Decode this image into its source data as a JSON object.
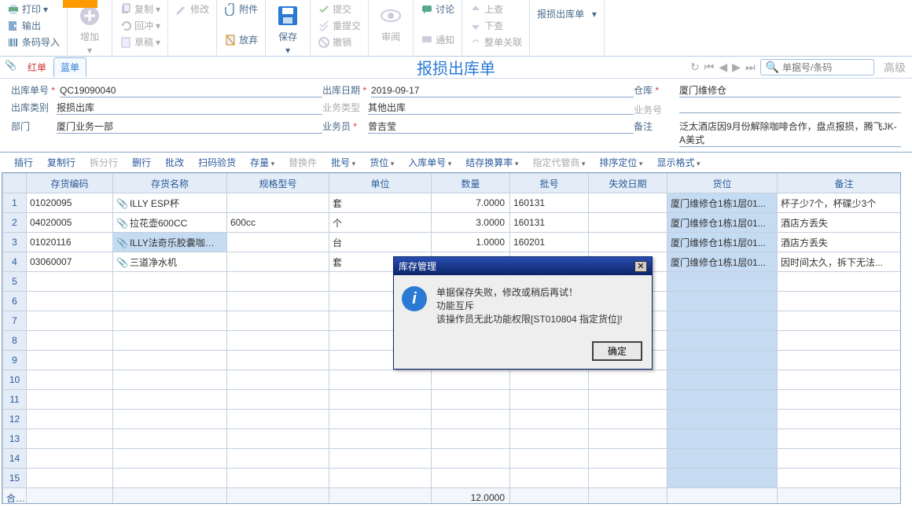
{
  "ribbon": {
    "print": "打印",
    "output": "输出",
    "barcode_import": "条码导入",
    "add": "增加",
    "copy": "复制",
    "return": "回冲",
    "draft": "草稿",
    "modify": "修改",
    "attachment": "附件",
    "abandon": "放弃",
    "save": "保存",
    "submit": "提交",
    "resubmit": "重提交",
    "revoke": "撤销",
    "review": "审阅",
    "discuss": "讨论",
    "notify": "通知",
    "check_up": "上查",
    "check_down": "下查",
    "close_rel": "整单关联",
    "doc_type": "报损出库单"
  },
  "tabs": {
    "red": "红单",
    "blue": "蓝单"
  },
  "title": "报损出库单",
  "search": {
    "placeholder": "单据号/条码",
    "adv": "高级"
  },
  "form": {
    "out_no_label": "出库单号",
    "out_no": "QC19090040",
    "out_cat_label": "出库类别",
    "out_cat": "报损出库",
    "dept_label": "部门",
    "dept": "厦门业务一部",
    "out_date_label": "出库日期",
    "out_date": "2019-09-17",
    "biz_type_label": "业务类型",
    "biz_type": "其他出库",
    "clerk_label": "业务员",
    "clerk": "曾吉莹",
    "wh_label": "仓库",
    "wh": "厦门维修仓",
    "biz_no_label": "业务号",
    "remark_label": "备注",
    "remark": "泛太酒店因9月份解除咖啡合作，盘点报损，腾飞JK-A美式"
  },
  "grid_toolbar": {
    "insert": "插行",
    "copyrow": "复制行",
    "split": "拆分行",
    "del": "删行",
    "batch_modify": "批改",
    "scan": "扫码验货",
    "stock": "存量",
    "replace": "替换件",
    "batch": "批号",
    "loc": "货位",
    "in_no": "入库单号",
    "settle": "结存换算率",
    "agent": "指定代管商",
    "sort": "排序定位",
    "display": "显示格式"
  },
  "cols": {
    "code": "存货编码",
    "name": "存货名称",
    "spec": "规格型号",
    "unit": "单位",
    "qty": "数量",
    "batch": "批号",
    "expire": "失效日期",
    "loc": "货位",
    "remark": "备注",
    "total": "合计"
  },
  "rows": [
    {
      "code": "01020095",
      "name": "ILLY ESP杯",
      "spec": "",
      "unit": "套",
      "qty": "7.0000",
      "batch": "160131",
      "loc": "厦门维修仓1栋1层01...",
      "remark": "杯子少7个，杯碟少3个"
    },
    {
      "code": "04020005",
      "name": "拉花壶600CC",
      "spec": "600cc",
      "unit": "个",
      "qty": "3.0000",
      "batch": "160131",
      "loc": "厦门维修仓1栋1层01...",
      "remark": "酒店方丢失"
    },
    {
      "code": "01020116",
      "name": "ILLY法奇乐胶囊咖啡机",
      "spec": "",
      "unit": "台",
      "qty": "1.0000",
      "batch": "160201",
      "loc": "厦门维修仓1栋1层01...",
      "remark": "酒店方丢失"
    },
    {
      "code": "03060007",
      "name": "三道净水机",
      "spec": "",
      "unit": "套",
      "qty": "",
      "batch": "",
      "loc": "厦门维修仓1栋1层01...",
      "remark": "因时间太久，拆下无法..."
    }
  ],
  "total_qty": "12.0000",
  "dialog": {
    "title": "库存管理",
    "line1": "单据保存失败，修改或稍后再试！",
    "line2": "功能互斥",
    "line3": "该操作员无此功能权限[ST010804 指定货位]!",
    "ok": "确定"
  }
}
